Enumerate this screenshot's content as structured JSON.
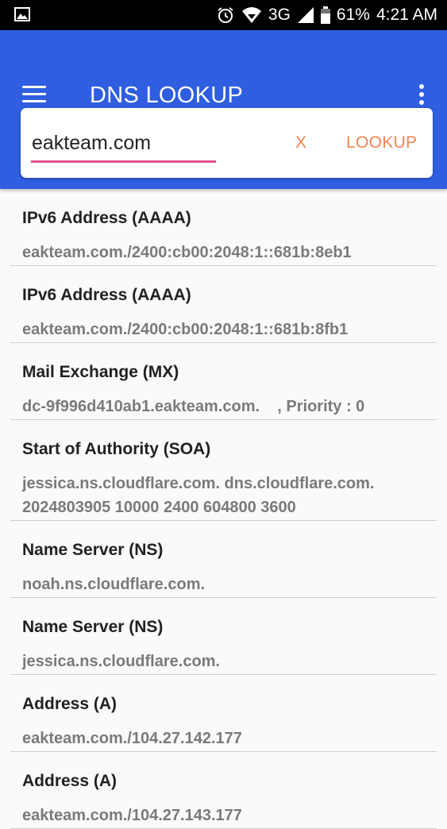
{
  "status_bar": {
    "network": "3G",
    "battery": "61%",
    "time": "4:21 AM",
    "icons": [
      "gallery-icon",
      "alarm-icon",
      "wifi-icon",
      "signal-icon",
      "battery-icon"
    ]
  },
  "app_bar": {
    "title": "DNS LOOKUP",
    "background_color": "#2f5ee0"
  },
  "search": {
    "query_value": "eakteam.com",
    "clear_label": "X",
    "lookup_label": "LOOKUP",
    "accent_color": "#f08450",
    "underline_color": "#e0528a"
  },
  "results": [
    {
      "type": "IPv6 Address (AAAA)",
      "value": "eakteam.com./2400:cb00:2048:1::681b:8eb1"
    },
    {
      "type": "IPv6 Address (AAAA)",
      "value": "eakteam.com./2400:cb00:2048:1::681b:8fb1"
    },
    {
      "type": "Mail Exchange (MX)",
      "value": "dc-9f996d410ab1.eakteam.com.    , Priority : 0"
    },
    {
      "type": "Start of Authority (SOA)",
      "value": "jessica.ns.cloudflare.com. dns.cloudflare.com. 2024803905 10000 2400 604800 3600"
    },
    {
      "type": "Name Server (NS)",
      "value": "noah.ns.cloudflare.com."
    },
    {
      "type": "Name Server (NS)",
      "value": "jessica.ns.cloudflare.com."
    },
    {
      "type": "Address (A)",
      "value": "eakteam.com./104.27.142.177"
    },
    {
      "type": "Address (A)",
      "value": "eakteam.com./104.27.143.177"
    }
  ]
}
